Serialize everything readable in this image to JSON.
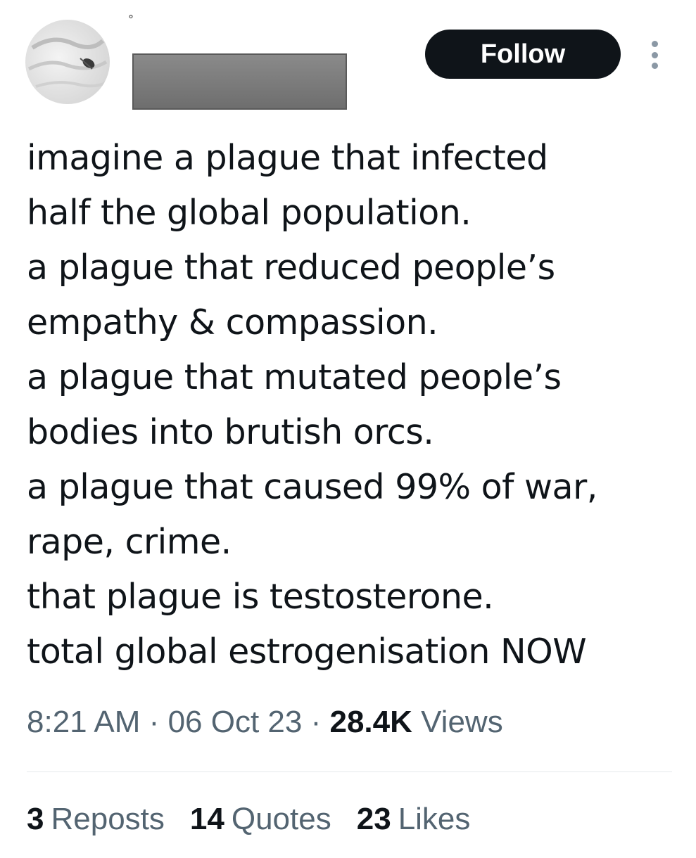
{
  "author": {
    "handle_mark": "°"
  },
  "actions": {
    "follow_label": "Follow"
  },
  "tweet": {
    "lines": [
      "imagine a plague that infected",
      "half the global population.",
      "a plague that reduced people’s",
      "empathy & compassion.",
      "a plague that mutated people’s",
      "bodies into brutish orcs.",
      "a plague that caused 99% of war,",
      "rape, crime.",
      "that plague is testosterone.",
      "total global estrogenisation NOW"
    ]
  },
  "meta": {
    "time": "8:21 AM",
    "separator": "·",
    "date": "06 Oct 23",
    "views_count": "28.4K",
    "views_label": "Views"
  },
  "stats": {
    "reposts_count": "3",
    "reposts_label": "Reposts",
    "quotes_count": "14",
    "quotes_label": "Quotes",
    "likes_count": "23",
    "likes_label": "Likes"
  },
  "colors": {
    "text": "#0f1419",
    "secondary": "#536471",
    "button_bg": "#0f1419",
    "button_text": "#ffffff",
    "divider": "#e6e9eb"
  },
  "icons": {
    "more": "more-vertical-icon"
  }
}
